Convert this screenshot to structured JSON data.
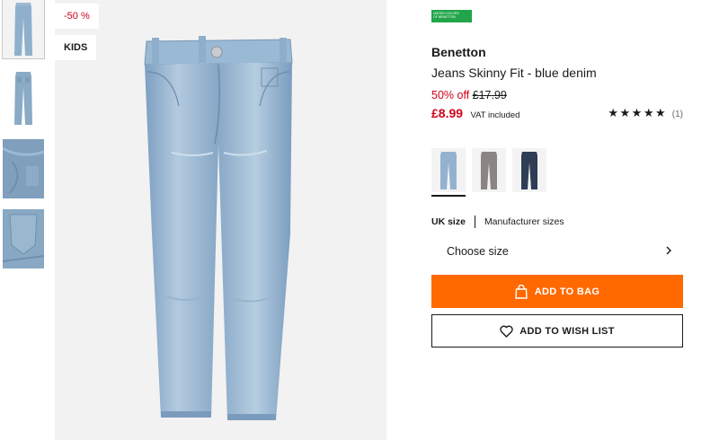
{
  "badges": {
    "discount": "-50 %",
    "category": "KIDS"
  },
  "thumbnails": [
    {
      "name": "thumb-front-full",
      "icon": "jeans-front-icon"
    },
    {
      "name": "thumb-back-full",
      "icon": "jeans-back-icon"
    },
    {
      "name": "thumb-detail-front",
      "icon": "denim-detail-icon"
    },
    {
      "name": "thumb-detail-pocket",
      "icon": "denim-pocket-icon"
    }
  ],
  "product": {
    "brand_logo_text": "UNITED COLORS OF BENETTON.",
    "brand": "Benetton",
    "title": "Jeans Skinny Fit - blue denim",
    "discount_pct": "50% off",
    "old_price": "£17.99",
    "price": "£8.99",
    "vat": "VAT included",
    "rating_stars": "★★★★★",
    "rating_count": "(1)",
    "rating_value": 5
  },
  "colors": {
    "brand_green": "#22a44a",
    "accent_orange": "#ff6900",
    "sale_red": "#d0021b",
    "swatches": [
      "light blue denim",
      "grey denim",
      "dark blue denim"
    ]
  },
  "sizes": {
    "tab_uk": "UK size",
    "tab_manufacturer": "Manufacturer sizes",
    "select_label": "Choose size"
  },
  "actions": {
    "add_to_bag": "ADD TO BAG",
    "add_to_wishlist": "ADD TO WISH LIST"
  }
}
